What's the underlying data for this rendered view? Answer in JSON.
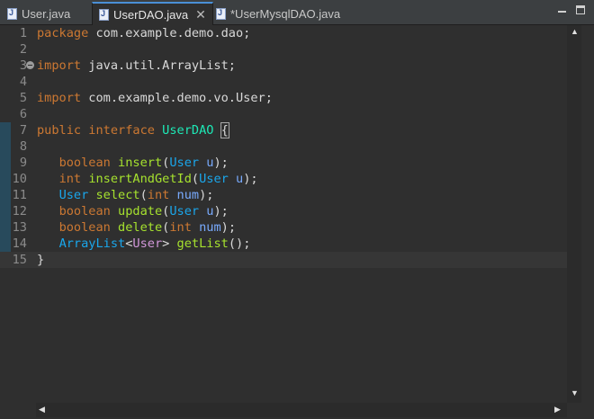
{
  "tabs": [
    {
      "label": "User.java",
      "active": false
    },
    {
      "label": "UserDAO.java",
      "active": true
    },
    {
      "label": "*UserMysqlDAO.java",
      "active": false
    }
  ],
  "icons": {
    "tab_file": "java-file-icon",
    "close": "close-icon",
    "minimize": "minimize-icon",
    "maximize": "maximize-icon",
    "fold": "fold-collapse-icon"
  },
  "editor": {
    "line_numbers": [
      "1",
      "2",
      "3",
      "4",
      "5",
      "6",
      "7",
      "8",
      "9",
      "10",
      "11",
      "12",
      "13",
      "14",
      "15"
    ],
    "current_line": 15,
    "code": {
      "l1": {
        "kw": "package",
        "rest": " com.example.demo.dao;"
      },
      "l3": {
        "kw": "import",
        "rest": " java.util.ArrayList;"
      },
      "l5": {
        "kw": "import",
        "rest": " com.example.demo.vo.User;"
      },
      "l7": {
        "kw1": "public",
        "kw2": "interface",
        "name": "UserDAO",
        "brace": "{"
      },
      "l9": {
        "type": "boolean",
        "method": "insert",
        "paren_open": "(",
        "ptype": "User",
        "pname": "u",
        "end": ");"
      },
      "l10": {
        "type": "int",
        "method": "insertAndGetId",
        "paren_open": "(",
        "ptype": "User",
        "pname": "u",
        "end": ");"
      },
      "l11": {
        "type": "User",
        "method": "select",
        "paren_open": "(",
        "ptype": "int",
        "pname": "num",
        "end": ");"
      },
      "l12": {
        "type": "boolean",
        "method": "update",
        "paren_open": "(",
        "ptype": "User",
        "pname": "u",
        "end": ");"
      },
      "l13": {
        "type": "boolean",
        "method": "delete",
        "paren_open": "(",
        "ptype": "int",
        "pname": "num",
        "end": ");"
      },
      "l14": {
        "type": "ArrayList",
        "lt": "<",
        "generic": "User",
        "gt": ">",
        "method": "getList",
        "end": "();"
      },
      "l15": {
        "text": "}"
      }
    }
  },
  "colors": {
    "keyword": "#cc7832",
    "type": "#1aa7ec",
    "method": "#a6e22e",
    "param": "#79abff",
    "class_name": "#1de9b6",
    "generic": "#d197d9",
    "text": "#d9d9d9",
    "background": "#2f2f2f"
  }
}
